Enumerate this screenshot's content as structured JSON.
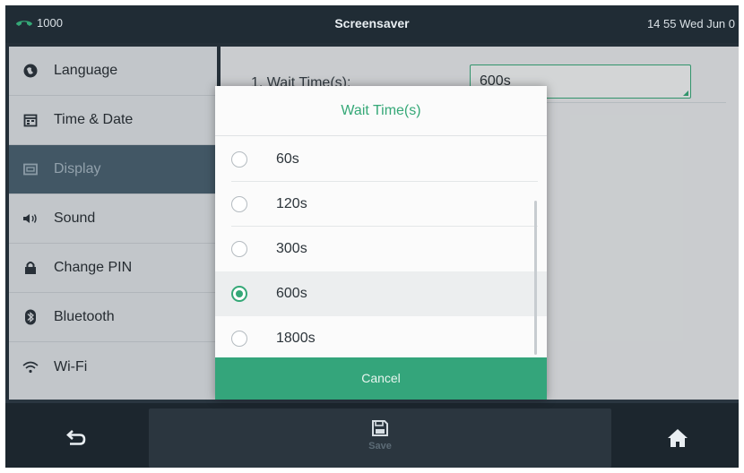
{
  "statusbar": {
    "line_icon": "phone-handset-icon",
    "line_number": "1000",
    "title": "Screensaver",
    "datetime": "14 55 Wed Jun 0"
  },
  "sidebar": {
    "items": [
      {
        "label": "Language",
        "icon": "globe-icon"
      },
      {
        "label": "Time & Date",
        "icon": "calendar-icon"
      },
      {
        "label": "Display",
        "icon": "display-icon"
      },
      {
        "label": "Sound",
        "icon": "speaker-icon"
      },
      {
        "label": "Change PIN",
        "icon": "lock-icon"
      },
      {
        "label": "Bluetooth",
        "icon": "bluetooth-icon"
      },
      {
        "label": "Wi-Fi",
        "icon": "wifi-icon"
      }
    ],
    "active_index": 2
  },
  "content": {
    "field_label": "1. Wait Time(s):",
    "field_value": "600s"
  },
  "modal": {
    "title": "Wait Time(s)",
    "options": [
      "60s",
      "120s",
      "300s",
      "600s",
      "1800s"
    ],
    "selected": "600s",
    "cancel_label": "Cancel"
  },
  "bottombar": {
    "back_icon": "back-arrow-icon",
    "save_icon": "save-icon",
    "save_label": "Save",
    "home_icon": "home-icon"
  },
  "colors": {
    "accent": "#35a877",
    "statusbar": "#202c35",
    "sidebar_active": "#4c6474"
  }
}
